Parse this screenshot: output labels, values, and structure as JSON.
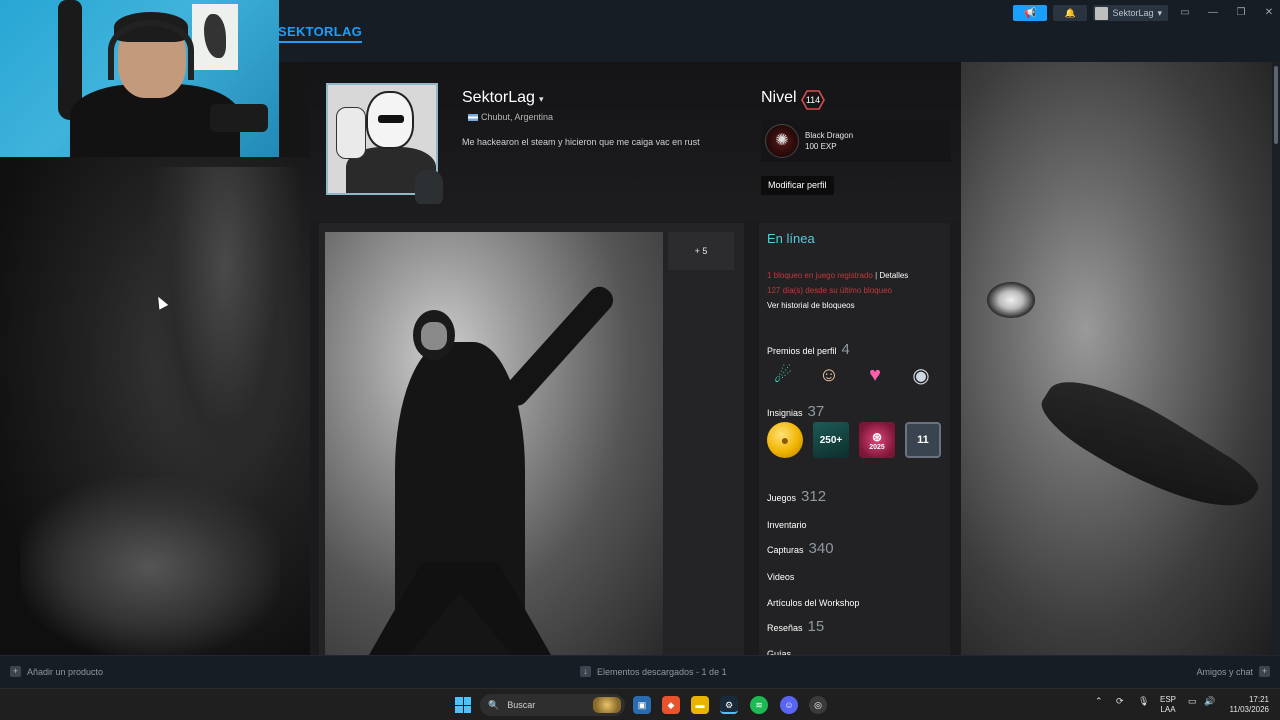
{
  "topbar": {
    "nav_user_label": "SEKTORLAG",
    "account_name": "SektorLag",
    "account_caret": "▾"
  },
  "profile": {
    "username": "SektorLag",
    "username_caret": "▾",
    "location": "Chubut, Argentina",
    "summary": "Me hackearon el steam y hicieron que me caiga vac en rust",
    "level_label": "Nivel",
    "level_value": "114",
    "favorite_badge": {
      "name": "Black Dragon",
      "exp": "100 EXP"
    },
    "edit_button": "Modificar perfil",
    "showcase_more": "+ 5"
  },
  "sidebar": {
    "status": "En línea",
    "vac_line1": "1 bloqueo en juego registrado",
    "vac_separator": "|",
    "vac_details": "Detalles",
    "vac_line2": "127 día(s) desde su último bloqueo",
    "vac_history": "Ver historial de bloqueos",
    "awards_label": "Premios del perfil",
    "awards_count": "4",
    "badges_label": "Insignias",
    "badges_count": "37",
    "badge_250": "250+",
    "badge_2025": "2025",
    "badge_11": "11",
    "games_label": "Juegos",
    "games_count": "312",
    "inventory_label": "Inventario",
    "screenshots_label": "Capturas",
    "screenshots_count": "340",
    "videos_label": "Videos",
    "workshop_label": "Artículos del Workshop",
    "reviews_label": "Reseñas",
    "reviews_count": "15",
    "guides_label": "Guías"
  },
  "bottombar": {
    "add_product": "Añadir un producto",
    "downloads": "Elementos descargados - 1 de 1",
    "friends": "Amigos y chat"
  },
  "taskbar": {
    "search_label": "Buscar",
    "lang_top": "ESP",
    "lang_bottom": "LAA",
    "time": "17:21",
    "date": "11/03/2026"
  },
  "colors": {
    "accent": "#1a9fff",
    "online": "#57cbde",
    "vac_red": "#c0393a",
    "topbar": "#171d25"
  }
}
